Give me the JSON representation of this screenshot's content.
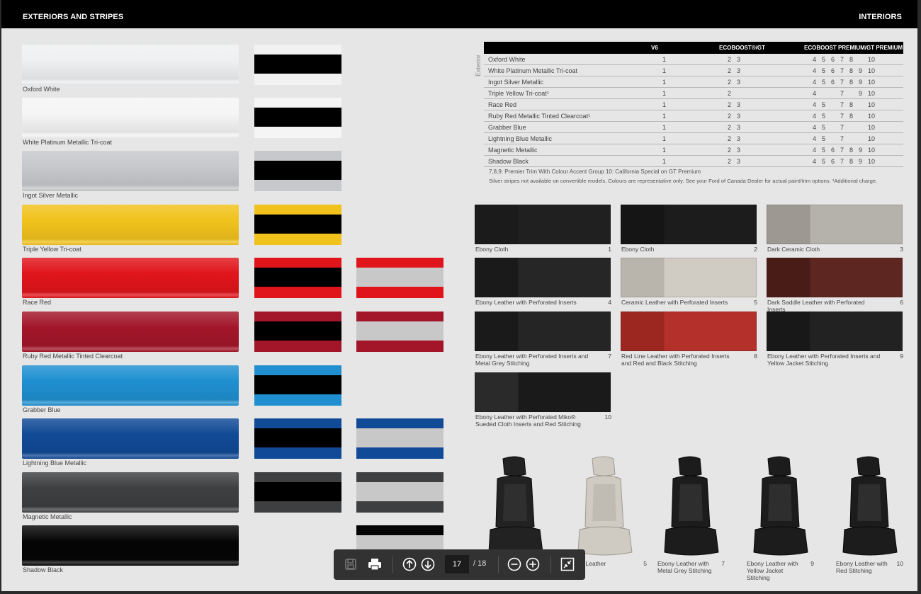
{
  "header": {
    "left_title": "EXTERIORS AND STRIPES",
    "right_title": "INTERIORS"
  },
  "exteriors": [
    {
      "name": "Oxford White",
      "color": "#eef0f1",
      "stripes": [
        {
          "bg": "#f2f2f2",
          "band": "#000"
        }
      ]
    },
    {
      "name": "White Platinum Metallic Tri-coat",
      "color": "#f5f5f5",
      "stripes": [
        {
          "bg": "#f5f5f5",
          "band": "#000"
        }
      ]
    },
    {
      "name": "Ingot Silver Metallic",
      "color": "#c7c8cb",
      "stripes": [
        {
          "bg": "#c7c8cb",
          "band": "#000"
        }
      ]
    },
    {
      "name": "Triple Yellow Tri-coat",
      "color": "#f1c21c",
      "stripes": [
        {
          "bg": "#f1c21c",
          "band": "#000"
        }
      ]
    },
    {
      "name": "Race Red",
      "color": "#e0151b",
      "stripes": [
        {
          "bg": "#e0151b",
          "band": "#000"
        },
        {
          "bg": "#e0151b",
          "band": "#c8c8c8"
        }
      ]
    },
    {
      "name": "Ruby Red Metallic Tinted Clearcoat",
      "color": "#a3162a",
      "stripes": [
        {
          "bg": "#a3162a",
          "band": "#000"
        },
        {
          "bg": "#a3162a",
          "band": "#c8c8c8"
        }
      ]
    },
    {
      "name": "Grabber Blue",
      "color": "#1f8fd0",
      "stripes": [
        {
          "bg": "#1f8fd0",
          "band": "#000"
        }
      ]
    },
    {
      "name": "Lightning Blue Metallic",
      "color": "#114a96",
      "stripes": [
        {
          "bg": "#114a96",
          "band": "#000"
        },
        {
          "bg": "#114a96",
          "band": "#c8c8c8"
        }
      ]
    },
    {
      "name": "Magnetic Metallic",
      "color": "#3e3f41",
      "stripes": [
        {
          "bg": "#3e3f41",
          "band": "#000"
        },
        {
          "bg": "#3e3f41",
          "band": "#c8c8c8"
        }
      ]
    },
    {
      "name": "Shadow Black",
      "color": "#050505",
      "stripes": [
        {
          "bg": "#050505",
          "band": "#c8c8c8"
        }
      ]
    }
  ],
  "trim_table": {
    "side_label": "Exterior",
    "headers": [
      "",
      "V6",
      "ECOBOOST®/GT",
      "ECOBOOST PREMIUM/GT PREMIUM"
    ],
    "rows": [
      {
        "name": "Oxford White",
        "v6": "1",
        "eco": [
          "2",
          "3"
        ],
        "prem": [
          "4",
          "5",
          "6",
          "7",
          "8",
          "",
          "10"
        ]
      },
      {
        "name": "White Platinum Metallic Tri-coat",
        "v6": "1",
        "eco": [
          "2",
          "3"
        ],
        "prem": [
          "4",
          "5",
          "6",
          "7",
          "8",
          "9",
          "10"
        ]
      },
      {
        "name": "Ingot Silver Metallic",
        "v6": "1",
        "eco": [
          "2",
          "3"
        ],
        "prem": [
          "4",
          "5",
          "6",
          "7",
          "8",
          "9",
          "10"
        ]
      },
      {
        "name": "Triple Yellow Tri-coat¹",
        "v6": "1",
        "eco": [
          "2",
          ""
        ],
        "prem": [
          "4",
          "",
          "",
          "7",
          "",
          "9",
          "10"
        ]
      },
      {
        "name": "Race Red",
        "v6": "1",
        "eco": [
          "2",
          "3"
        ],
        "prem": [
          "4",
          "5",
          "",
          "7",
          "8",
          "",
          "10"
        ]
      },
      {
        "name": "Ruby Red Metallic Tinted Clearcoat¹",
        "v6": "1",
        "eco": [
          "2",
          "3"
        ],
        "prem": [
          "4",
          "5",
          "",
          "7",
          "8",
          "",
          "10"
        ]
      },
      {
        "name": "Grabber Blue",
        "v6": "1",
        "eco": [
          "2",
          "3"
        ],
        "prem": [
          "4",
          "5",
          "",
          "7",
          "",
          "",
          "10"
        ]
      },
      {
        "name": "Lightning Blue Metallic",
        "v6": "1",
        "eco": [
          "2",
          "3"
        ],
        "prem": [
          "4",
          "5",
          "",
          "7",
          "",
          "",
          "10"
        ]
      },
      {
        "name": "Magnetic Metallic",
        "v6": "1",
        "eco": [
          "2",
          "3"
        ],
        "prem": [
          "4",
          "5",
          "6",
          "7",
          "8",
          "9",
          "10"
        ]
      },
      {
        "name": "Shadow Black",
        "v6": "1",
        "eco": [
          "2",
          "3"
        ],
        "prem": [
          "4",
          "5",
          "6",
          "7",
          "8",
          "9",
          "10"
        ]
      }
    ],
    "note1": "7,8,9: Premier Trim With Colour Accent Group   10: California Special on GT Premium",
    "note2": "Silver stripes not available on convertible models. Colours are representative only. See your Ford of Canada Dealer for actual paint/trim options. ¹Additional charge."
  },
  "interiors": [
    {
      "label": "Ebony Cloth",
      "num": "1",
      "colorA": "#1b1b1b",
      "colorB": "#202020"
    },
    {
      "label": "Ebony Cloth",
      "num": "2",
      "colorA": "#151515",
      "colorB": "#1c1c1c"
    },
    {
      "label": "Dark Ceramic Cloth",
      "num": "3",
      "colorA": "#9d9892",
      "colorB": "#b5b2ab"
    },
    {
      "label": "Ebony Leather with Perforated Inserts",
      "num": "4",
      "colorA": "#1a1a1a",
      "colorB": "#262626"
    },
    {
      "label": "Ceramic Leather with Perforated Inserts",
      "num": "5",
      "colorA": "#b9b5ad",
      "colorB": "#d0ccc4"
    },
    {
      "label": "Dark Saddle Leather with Perforated Inserts",
      "num": "6",
      "colorA": "#4a1c18",
      "colorB": "#5e2620"
    },
    {
      "label": "Ebony Leather with Perforated Inserts and Metal Grey Stitching",
      "num": "7",
      "colorA": "#1a1a1a",
      "colorB": "#252525"
    },
    {
      "label": "Red Line Leather with Perforated Inserts and Red and Black Stitching",
      "num": "8",
      "colorA": "#9c2720",
      "colorB": "#b4302a"
    },
    {
      "label": "Ebony Leather with Perforated Inserts and Yellow Jacket Stitching",
      "num": "9",
      "colorA": "#181818",
      "colorB": "#222222"
    },
    {
      "label": "Ebony Leather with Perforated Miko® Sueded Cloth Inserts and Red Stitching",
      "num": "10",
      "colorA": "#2a2a2a",
      "colorB": "#1a1a1a"
    }
  ],
  "seats": [
    {
      "label": "",
      "num": "",
      "color": "#222"
    },
    {
      "label": "ic Leather",
      "num": "5",
      "color": "#cfcbc2"
    },
    {
      "label": "Ebony Leather with Metal Grey Stitching",
      "num": "7",
      "color": "#1c1c1c"
    },
    {
      "label": "Ebony Leather with Yellow Jacket Stitching",
      "num": "9",
      "color": "#1c1c1c"
    },
    {
      "label": "Ebony Leather with Red Stitching",
      "num": "10",
      "color": "#1c1c1c"
    }
  ],
  "toolbar": {
    "page_current": "17",
    "page_total": "/  18"
  }
}
